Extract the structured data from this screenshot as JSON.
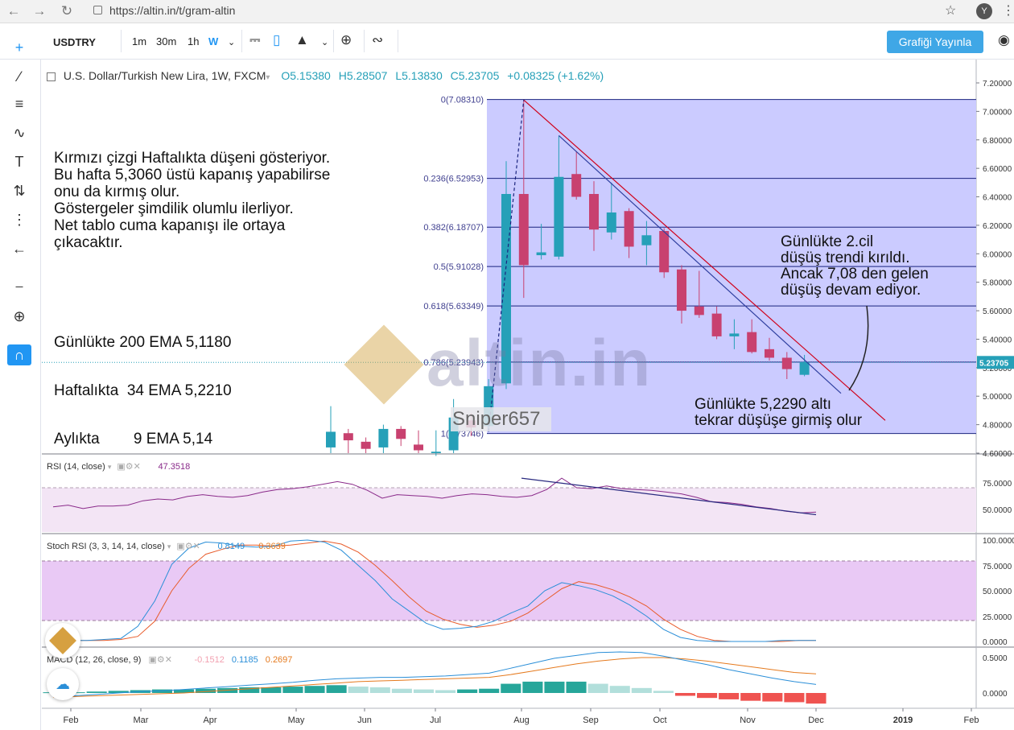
{
  "browser": {
    "url": "https://altin.in/t/gram-altin",
    "profile_initial": "Y"
  },
  "toolbar": {
    "symbol": "USDTRY",
    "intervals": [
      "1m",
      "30m",
      "1h",
      "W"
    ],
    "active_interval": "W",
    "publish_label": "Grafiği Yayınla"
  },
  "legend": {
    "title": "U.S. Dollar/Turkish New Lira, 1W, FXCM",
    "open": "O5.15380",
    "high": "H5.28507",
    "low": "L5.13830",
    "close": "C5.23705",
    "change": "+0.08325 (+1.62%)"
  },
  "annotations": {
    "main_text": [
      "Kırmızı çizgi Haftalıkta düşeni gösteriyor.",
      "Bu hafta 5,3060 üstü kapanış yapabilirse",
      "onu da kırmış olur.",
      "Göstergeler şimdilik olumlu ilerliyor.",
      "Net tablo cuma kapanışı ile ortaya",
      "çıkacaktır."
    ],
    "ema_text": [
      "Günlükte 200 EMA 5,1180",
      "Haftalıkta  34 EMA 5,2210",
      "Aylıkta        9 EMA 5,14"
    ],
    "right_text": [
      "Günlükte 2.cil",
      "düşüş trendi kırıldı.",
      "Ancak 7,08 den gelen",
      "düşüş devam ediyor."
    ],
    "bottom_text": [
      "Günlükte 5,2290 altı",
      "tekrar düşüşe girmiş olur"
    ],
    "watermark": "altin.in",
    "author": "Sniper657"
  },
  "fib_levels": [
    {
      "label": "0(7.08310)",
      "value": 7.0831
    },
    {
      "label": "0.236(6.52953)",
      "value": 6.52953
    },
    {
      "label": "0.382(6.18707)",
      "value": 6.18707
    },
    {
      "label": "0.5(5.91028)",
      "value": 5.91028
    },
    {
      "label": "0.618(5.63349)",
      "value": 5.63349
    },
    {
      "label": "0.786(5.23943)",
      "value": 5.23943
    },
    {
      "label": "1(4.73746)",
      "value": 4.73746
    }
  ],
  "indicators": {
    "rsi": {
      "label": "RSI (14, close)",
      "value": "47.3518"
    },
    "stoch": {
      "label": "Stoch RSI (3, 3, 14, 14, close)",
      "k": "0.8149",
      "d": "0.3639"
    },
    "macd": {
      "label": "MACD (12, 26, close, 9)",
      "hist": "-0.1512",
      "macd": "0.1185",
      "signal": "0.2697"
    }
  },
  "price_axis": [
    "7.20000",
    "7.00000",
    "6.80000",
    "6.60000",
    "6.40000",
    "6.20000",
    "6.00000",
    "5.80000",
    "5.60000",
    "5.40000",
    "5.20000",
    "5.00000",
    "4.80000",
    "4.60000"
  ],
  "current_price": "5.23705",
  "rsi_axis": [
    "75.0000",
    "50.0000"
  ],
  "stoch_axis": [
    "100.0000",
    "75.0000",
    "50.0000",
    "25.0000",
    "0.0000"
  ],
  "macd_axis": [
    "0.5000",
    "0.0000"
  ],
  "time_axis": [
    "Feb",
    "Mar",
    "Apr",
    "May",
    "Jun",
    "Jul",
    "Aug",
    "Sep",
    "Oct",
    "Nov",
    "Dec",
    "2019",
    "Feb"
  ],
  "colors": {
    "up": "#26a0b8",
    "down": "#c8416f",
    "fib_zone": "#c8c8ff",
    "trend_red": "#d0021b",
    "trend_blue": "#3040a0"
  },
  "chart_data": {
    "type": "candlestick",
    "interval": "1W",
    "ylim": [
      4.6,
      7.2
    ],
    "candles": [
      {
        "o": 4.64,
        "h": 4.93,
        "l": 4.6,
        "c": 4.75
      },
      {
        "o": 4.74,
        "h": 4.77,
        "l": 4.6,
        "c": 4.69
      },
      {
        "o": 4.68,
        "h": 4.71,
        "l": 4.6,
        "c": 4.63
      },
      {
        "o": 4.64,
        "h": 4.8,
        "l": 4.6,
        "c": 4.77
      },
      {
        "o": 4.77,
        "h": 4.79,
        "l": 4.65,
        "c": 4.7
      },
      {
        "o": 4.66,
        "h": 4.76,
        "l": 4.6,
        "c": 4.62
      },
      {
        "o": 4.6,
        "h": 4.76,
        "l": 4.58,
        "c": 4.61
      },
      {
        "o": 4.62,
        "h": 4.98,
        "l": 4.6,
        "c": 4.85
      },
      {
        "o": 4.83,
        "h": 4.88,
        "l": 4.72,
        "c": 4.78
      },
      {
        "o": 4.79,
        "h": 5.12,
        "l": 4.75,
        "c": 5.07
      },
      {
        "o": 5.09,
        "h": 6.65,
        "l": 5.05,
        "c": 6.42
      },
      {
        "o": 6.42,
        "h": 7.08,
        "l": 5.69,
        "c": 5.92
      },
      {
        "o": 5.99,
        "h": 6.21,
        "l": 5.96,
        "c": 6.01
      },
      {
        "o": 5.98,
        "h": 6.83,
        "l": 5.96,
        "c": 6.54
      },
      {
        "o": 6.56,
        "h": 6.72,
        "l": 6.38,
        "c": 6.4
      },
      {
        "o": 6.42,
        "h": 6.51,
        "l": 6.02,
        "c": 6.17
      },
      {
        "o": 6.15,
        "h": 6.5,
        "l": 6.1,
        "c": 6.29
      },
      {
        "o": 6.3,
        "h": 6.32,
        "l": 5.97,
        "c": 6.05
      },
      {
        "o": 6.06,
        "h": 6.23,
        "l": 5.92,
        "c": 6.13
      },
      {
        "o": 6.16,
        "h": 6.18,
        "l": 5.83,
        "c": 5.87
      },
      {
        "o": 5.89,
        "h": 5.92,
        "l": 5.51,
        "c": 5.6
      },
      {
        "o": 5.63,
        "h": 5.88,
        "l": 5.55,
        "c": 5.57
      },
      {
        "o": 5.58,
        "h": 5.63,
        "l": 5.4,
        "c": 5.42
      },
      {
        "o": 5.42,
        "h": 5.54,
        "l": 5.33,
        "c": 5.44
      },
      {
        "o": 5.45,
        "h": 5.54,
        "l": 5.3,
        "c": 5.31
      },
      {
        "o": 5.33,
        "h": 5.41,
        "l": 5.25,
        "c": 5.27
      },
      {
        "o": 5.27,
        "h": 5.31,
        "l": 5.12,
        "c": 5.19
      },
      {
        "o": 5.15,
        "h": 5.29,
        "l": 5.14,
        "c": 5.24
      }
    ],
    "rsi": [
      53,
      55,
      51,
      54,
      54,
      55,
      60,
      62,
      61,
      65,
      67,
      65,
      64,
      66,
      70,
      73,
      74,
      76,
      79,
      82,
      79,
      72,
      63,
      67,
      66,
      65,
      63,
      66,
      68,
      67,
      65,
      64,
      66,
      73,
      86,
      75,
      74,
      77,
      74,
      73,
      72,
      70,
      68,
      64,
      59,
      58,
      56,
      53,
      51,
      48,
      46,
      47
    ],
    "stoch_k": [
      1,
      1,
      1,
      2,
      3,
      15,
      40,
      76,
      92,
      98,
      97,
      94,
      93,
      94,
      99,
      100,
      98,
      90,
      75,
      60,
      42,
      30,
      18,
      12,
      13,
      15,
      20,
      28,
      35,
      50,
      58,
      55,
      51,
      45,
      36,
      25,
      12,
      4,
      1,
      0,
      0,
      0,
      0,
      1,
      1,
      1
    ],
    "stoch_d": [
      1,
      1,
      1,
      1,
      2,
      5,
      20,
      50,
      72,
      86,
      91,
      95,
      95,
      94,
      95,
      97,
      99,
      96,
      88,
      75,
      60,
      44,
      30,
      22,
      17,
      14,
      16,
      20,
      28,
      40,
      52,
      59,
      56,
      51,
      44,
      35,
      22,
      12,
      5,
      1,
      0,
      0,
      0,
      0,
      1,
      1
    ],
    "macd_line": [
      -0.05,
      -0.04,
      -0.02,
      0.0,
      0.02,
      0.03,
      0.05,
      0.07,
      0.09,
      0.11,
      0.13,
      0.15,
      0.18,
      0.2,
      0.21,
      0.22,
      0.22,
      0.23,
      0.24,
      0.26,
      0.28,
      0.35,
      0.42,
      0.49,
      0.53,
      0.57,
      0.58,
      0.57,
      0.52,
      0.46,
      0.4,
      0.33,
      0.27,
      0.21,
      0.16,
      0.12
    ],
    "macd_signal": [
      -0.06,
      -0.05,
      -0.04,
      -0.03,
      -0.02,
      -0.01,
      0.0,
      0.02,
      0.04,
      0.06,
      0.08,
      0.1,
      0.12,
      0.14,
      0.16,
      0.17,
      0.18,
      0.19,
      0.2,
      0.21,
      0.22,
      0.26,
      0.31,
      0.36,
      0.41,
      0.45,
      0.48,
      0.5,
      0.5,
      0.48,
      0.45,
      0.41,
      0.37,
      0.33,
      0.29,
      0.27
    ],
    "macd_hist": [
      0.01,
      0.01,
      0.02,
      0.03,
      0.04,
      0.05,
      0.05,
      0.06,
      0.07,
      0.08,
      0.08,
      0.09,
      0.1,
      0.11,
      0.09,
      0.08,
      0.06,
      0.05,
      0.04,
      0.05,
      0.06,
      0.13,
      0.16,
      0.16,
      0.16,
      0.13,
      0.1,
      0.07,
      0.03,
      -0.04,
      -0.07,
      -0.09,
      -0.11,
      -0.12,
      -0.13,
      -0.15
    ]
  }
}
